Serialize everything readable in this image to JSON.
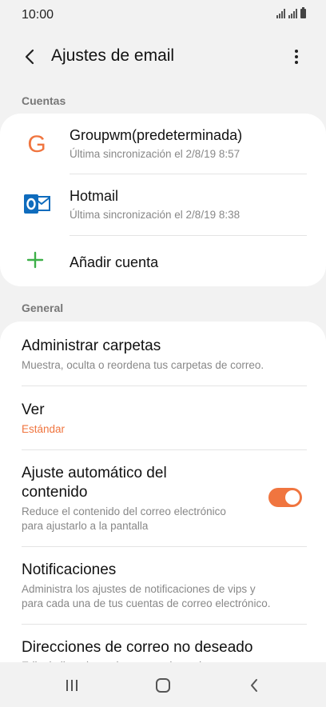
{
  "status_bar": {
    "time": "10:00"
  },
  "app_bar": {
    "title": "Ajustes de email"
  },
  "accounts_section": {
    "label": "Cuentas",
    "accounts": [
      {
        "name": "Groupwm(predeterminada)",
        "sync": "Última sincronización el 2/8/19  8:57",
        "icon": "g-letter-icon"
      },
      {
        "name": "Hotmail",
        "sync": "Última sincronización el 2/8/19  8:38",
        "icon": "outlook-icon"
      }
    ],
    "add_account": "Añadir cuenta"
  },
  "general_section": {
    "label": "General",
    "items": [
      {
        "title": "Administrar carpetas",
        "subtitle": "Muestra, oculta o reordena tus carpetas de correo."
      },
      {
        "title": "Ver",
        "subtitle": "Estándar"
      },
      {
        "title_line1": "Ajuste automático del",
        "title_line2": "contenido",
        "subtitle_line1": "Reduce el contenido del correo electrónico",
        "subtitle_line2": "para ajustarlo a la pantalla",
        "toggle_on": true
      },
      {
        "title": "Notificaciones",
        "subtitle_line1": "Administra los ajustes de notificaciones de vips y",
        "subtitle_line2": "para cada una de tus cuentas de correo electrónico."
      },
      {
        "title": "Direcciones de correo no deseado",
        "subtitle": "Edita la lista de remitentes no deseados."
      }
    ]
  },
  "colors": {
    "accent": "#f0753f",
    "add_green": "#3db049",
    "outlook_blue": "#0f6cbd"
  }
}
